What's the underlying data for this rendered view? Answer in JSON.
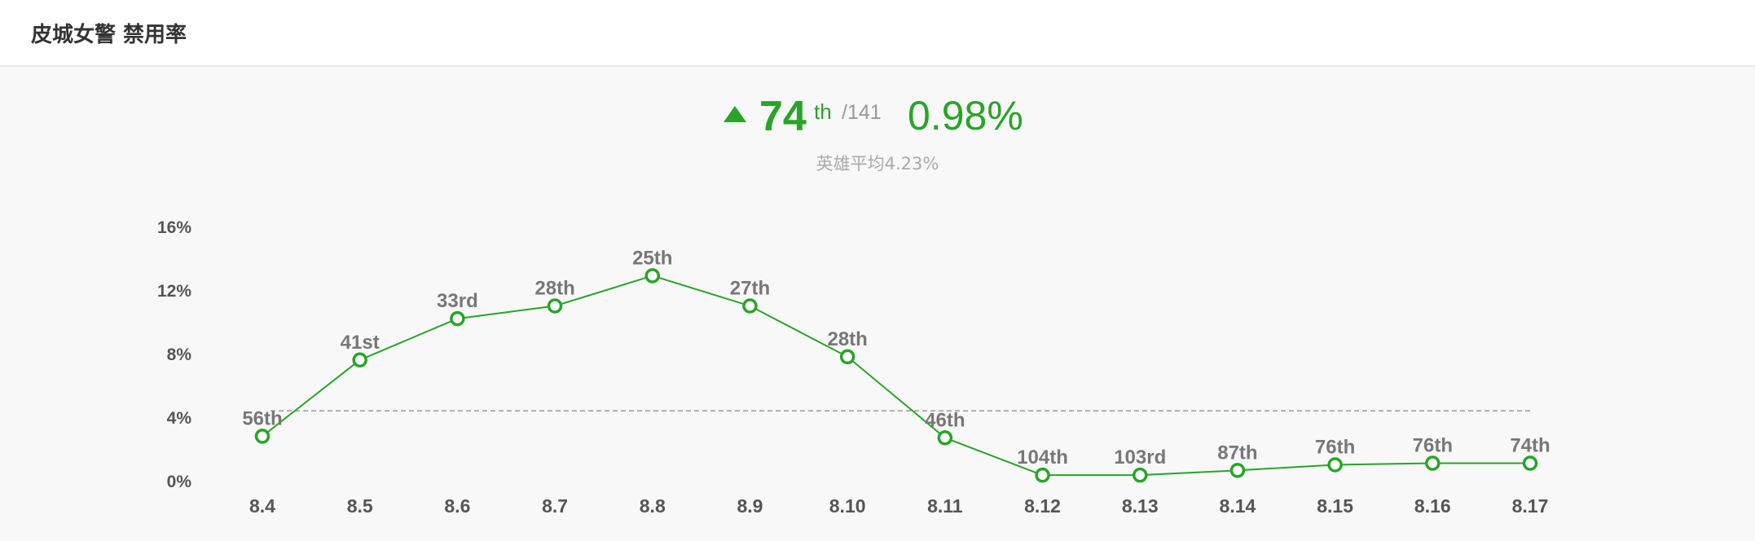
{
  "header": {
    "title": "皮城女警 禁用率"
  },
  "summary": {
    "rank": "74",
    "rank_suffix": "th",
    "rank_total": "/141",
    "rate": "0.98%",
    "average_text": "英雄平均4.23%",
    "trend": "up"
  },
  "colors": {
    "accent": "#28a428",
    "average_line": "#999999",
    "axis_text": "#555555",
    "label_text": "#777777"
  },
  "chart_data": {
    "type": "line",
    "categories": [
      "8.4",
      "8.5",
      "8.6",
      "8.7",
      "8.8",
      "8.9",
      "8.10",
      "8.11",
      "8.12",
      "8.13",
      "8.14",
      "8.15",
      "8.16",
      "8.17"
    ],
    "series": [
      {
        "values": [
          2.8,
          7.6,
          10.2,
          11.0,
          12.9,
          11.0,
          7.8,
          2.7,
          0.35,
          0.35,
          0.65,
          1.0,
          1.1,
          1.1
        ],
        "labels": [
          "56th",
          "41st",
          "33rd",
          "28th",
          "25th",
          "27th",
          "28th",
          "46th",
          "104th",
          "103rd",
          "87th",
          "76th",
          "76th",
          "74th"
        ]
      }
    ],
    "reference_line": {
      "value": 4.4
    },
    "yticks": [
      "0%",
      "4%",
      "8%",
      "12%",
      "16%"
    ],
    "ylim": [
      0,
      16
    ],
    "grid": false,
    "legend": "none"
  }
}
